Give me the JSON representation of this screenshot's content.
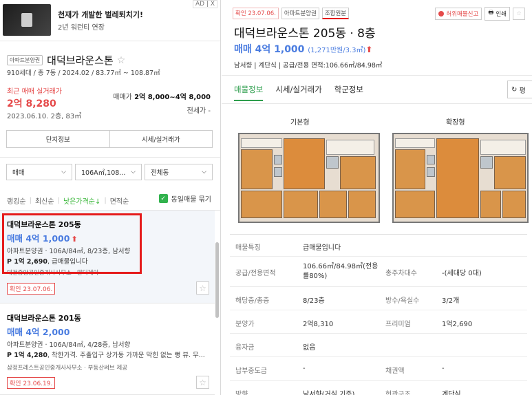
{
  "ad": {
    "badge": "AD | X",
    "title": "천재가 개발한 벌레퇴치기!",
    "subtitle": "2년 워런티 연장"
  },
  "complex": {
    "tag": "아파트분양권",
    "name": "대덕브라운스톤",
    "star": "☆",
    "info": "910세대 / 총 7동 / 2024.02 / 83.77㎡ ~ 108.87㎡",
    "recent_label": "최근 매매 실거래가",
    "recent_price": "2억 8,280",
    "recent_date": "2023.06.10. 2층, 83㎡",
    "range_label": "매매가",
    "range_value": "2억 8,000~4억 8,000",
    "jeonse": "전세가 -",
    "btn_info": "단지정보",
    "btn_trade": "시세/실거래가"
  },
  "filters": {
    "trade": "매매",
    "area": "106A㎡,108...",
    "dong": "전체동"
  },
  "sorts": {
    "s1": "랭킹순",
    "s2": "최신순",
    "s3": "낮은가격순↓",
    "s4": "면적순",
    "same": "동일매물 묶기"
  },
  "listings": [
    {
      "name": "대덕브라운스톤 205동",
      "price": "매매 4억 1,000",
      "up": "⬆",
      "spec": "아파트분양권 · 106A/84㎡, 8/23층, 남서향",
      "desc_p": "P 1억 2,690",
      "desc": ", 급매물입니다",
      "agent": "대전중앙공인중개사사무소 · 알터레이",
      "confirm": "확인 23.07.06."
    },
    {
      "name": "대덕브라운스톤 201동",
      "price": "매매 4억 2,000",
      "spec": "아파트분양권 · 106A/84㎡, 4/28층, 남서향",
      "desc_p": "P 1억 4,280",
      "desc": ", 착한가격. 주출입구 상가동 가까운 막힌 없는 뻥 뷰. 무...",
      "agent": "삼정프레스트공인중개사사무소 · 부동산써브 제공",
      "confirm": "확인 23.06.19."
    }
  ],
  "detail": {
    "tag_confirm": "확인 23.07.06.",
    "tag_type": "아파트분양권",
    "tag_member": "조합원분",
    "report": "허위매물신고",
    "print": "인쇄",
    "title": "대덕브라운스톤 205동 · 8층",
    "price": "매매 4억 1,000",
    "price_unit": "(1,271만원/3.3㎡)",
    "up": "⬆",
    "sub": "남서향 | 계단식 | 공급/전용 면적:106.66㎡/84.98㎡",
    "tabs": [
      "매물정보",
      "시세/실거래가",
      "학군정보"
    ],
    "pyeong": "평",
    "fp_basic": "기본형",
    "fp_ext": "확장형"
  },
  "table": [
    {
      "k1": "매물특징",
      "v1": "급매물입니다"
    },
    {
      "k1": "공급/전용면적",
      "v1": "106.66㎡/84.98㎡(전용률80%)",
      "k2": "총주차대수",
      "v2": "-(세대당 0대)"
    },
    {
      "k1": "해당층/총층",
      "v1": "8/23층",
      "k2": "방수/욕실수",
      "v2": "3/2개"
    },
    {
      "k1": "분양가",
      "v1": "2억8,310",
      "k2": "프리미엄",
      "v2": "1억2,690"
    },
    {
      "k1": "융자금",
      "v1": "없음"
    },
    {
      "k1": "납부중도금",
      "v1": "-",
      "k2": "채권액",
      "v2": "-"
    },
    {
      "k1": "방향",
      "v1": "남서향(거실 기준)",
      "k2": "현관구조",
      "v2": "계단식"
    }
  ]
}
